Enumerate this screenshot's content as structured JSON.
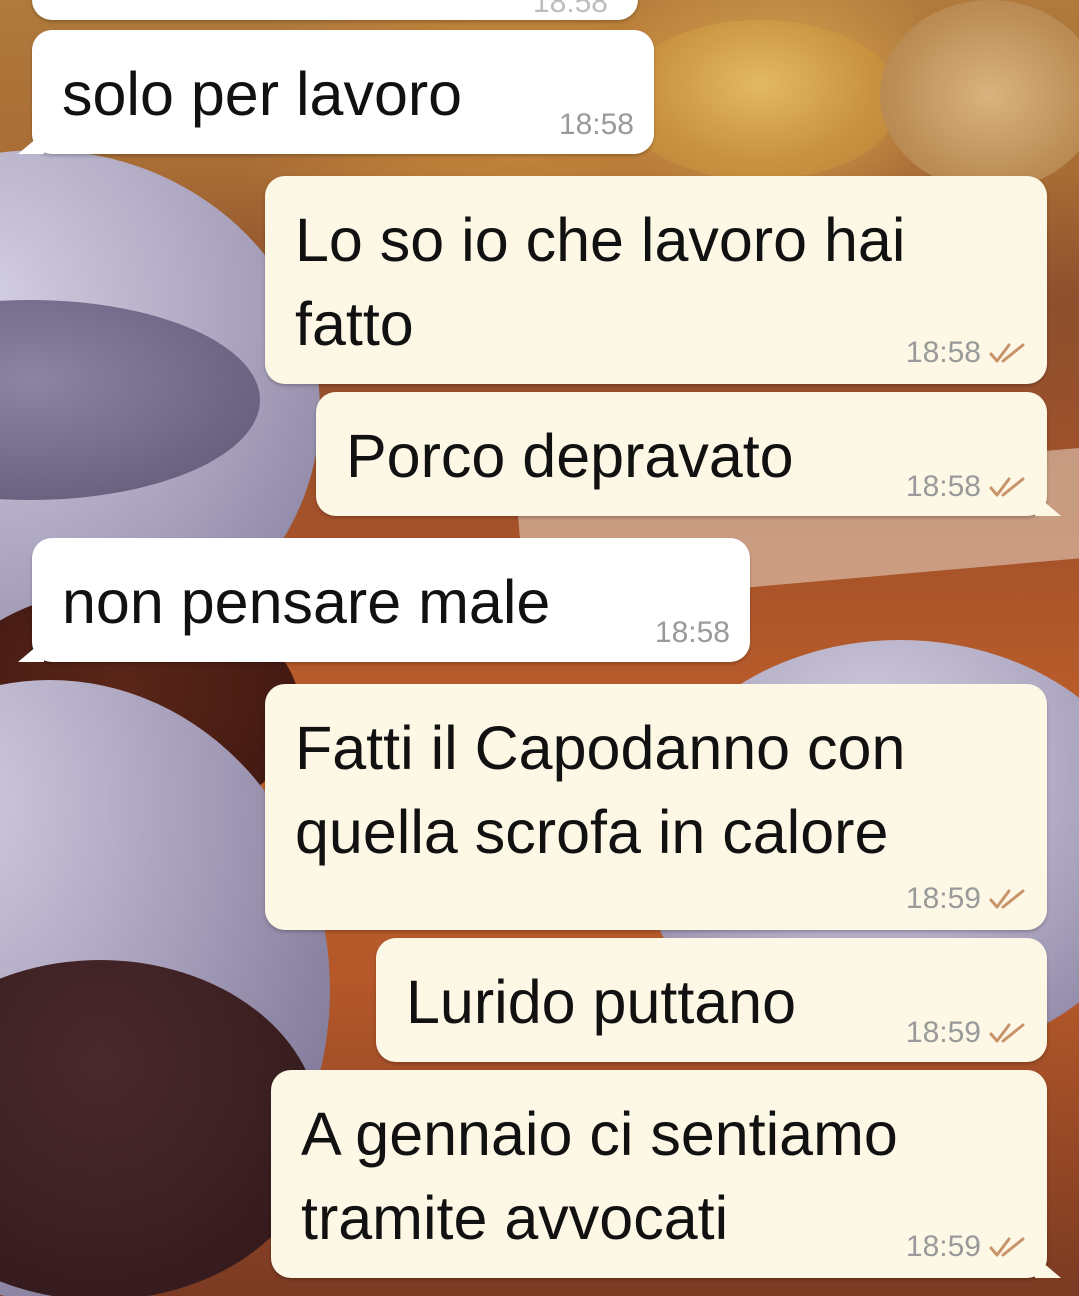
{
  "conversation": {
    "messages": [
      {
        "direction": "incoming",
        "text": "",
        "time": "18:58"
      },
      {
        "direction": "incoming",
        "text": "solo per lavoro",
        "time": "18:58"
      },
      {
        "direction": "outgoing",
        "text": "Lo so io che lavoro hai\nfatto",
        "time": "18:58",
        "status": "read"
      },
      {
        "direction": "outgoing",
        "text": "Porco depravato",
        "time": "18:58",
        "status": "read"
      },
      {
        "direction": "incoming",
        "text": "non pensare male",
        "time": "18:58"
      },
      {
        "direction": "outgoing",
        "text": "Fatti il Capodanno con\nquella scrofa in calore",
        "time": "18:59",
        "status": "read"
      },
      {
        "direction": "outgoing",
        "text": "Lurido puttano",
        "time": "18:59",
        "status": "read"
      },
      {
        "direction": "outgoing",
        "text": "A gennaio ci sentiamo\ntramite avvocati",
        "time": "18:59",
        "status": "read"
      }
    ]
  },
  "colors": {
    "incoming_bubble": "#ffffff",
    "outgoing_bubble": "#fdf7e6",
    "timestamp": "#9a9a9a",
    "read_ticks": "#c8946a"
  },
  "icons": {
    "read_receipt": "double-check-icon"
  }
}
